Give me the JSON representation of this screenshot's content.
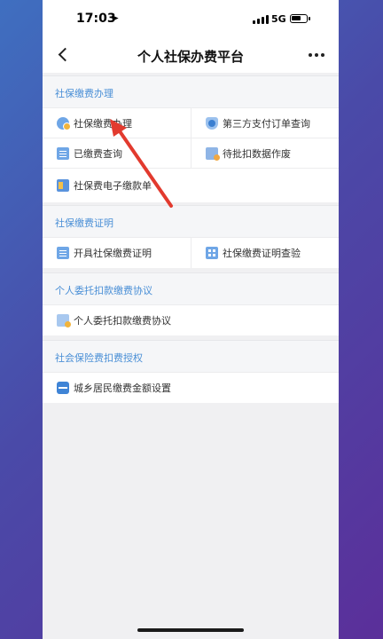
{
  "status_bar": {
    "time": "17:03",
    "network": "5G"
  },
  "nav": {
    "title": "个人社保办费平台"
  },
  "sections": [
    {
      "title": "社保缴费办理",
      "items": [
        {
          "label": "社保缴费办理",
          "icon": "user-badge-icon"
        },
        {
          "label": "第三方支付订单查询",
          "icon": "shield-icon"
        },
        {
          "label": "已缴费查询",
          "icon": "document-icon"
        },
        {
          "label": "待批扣数据作废",
          "icon": "pending-document-icon"
        },
        {
          "label": "社保费电子缴款单",
          "icon": "payment-card-icon"
        }
      ]
    },
    {
      "title": "社保缴费证明",
      "items": [
        {
          "label": "开具社保缴费证明",
          "icon": "document-icon"
        },
        {
          "label": "社保缴费证明查验",
          "icon": "verify-grid-icon"
        }
      ]
    },
    {
      "title": "个人委托扣款缴费协议",
      "items": [
        {
          "label": "个人委托扣款缴费协议",
          "icon": "agreement-icon"
        }
      ]
    },
    {
      "title": "社会保险费扣费授权",
      "items": [
        {
          "label": "城乡居民缴费金额设置",
          "icon": "wallet-icon"
        }
      ]
    }
  ],
  "colors": {
    "accent": "#4a8fd6",
    "annotation_arrow": "#e23a2e"
  }
}
